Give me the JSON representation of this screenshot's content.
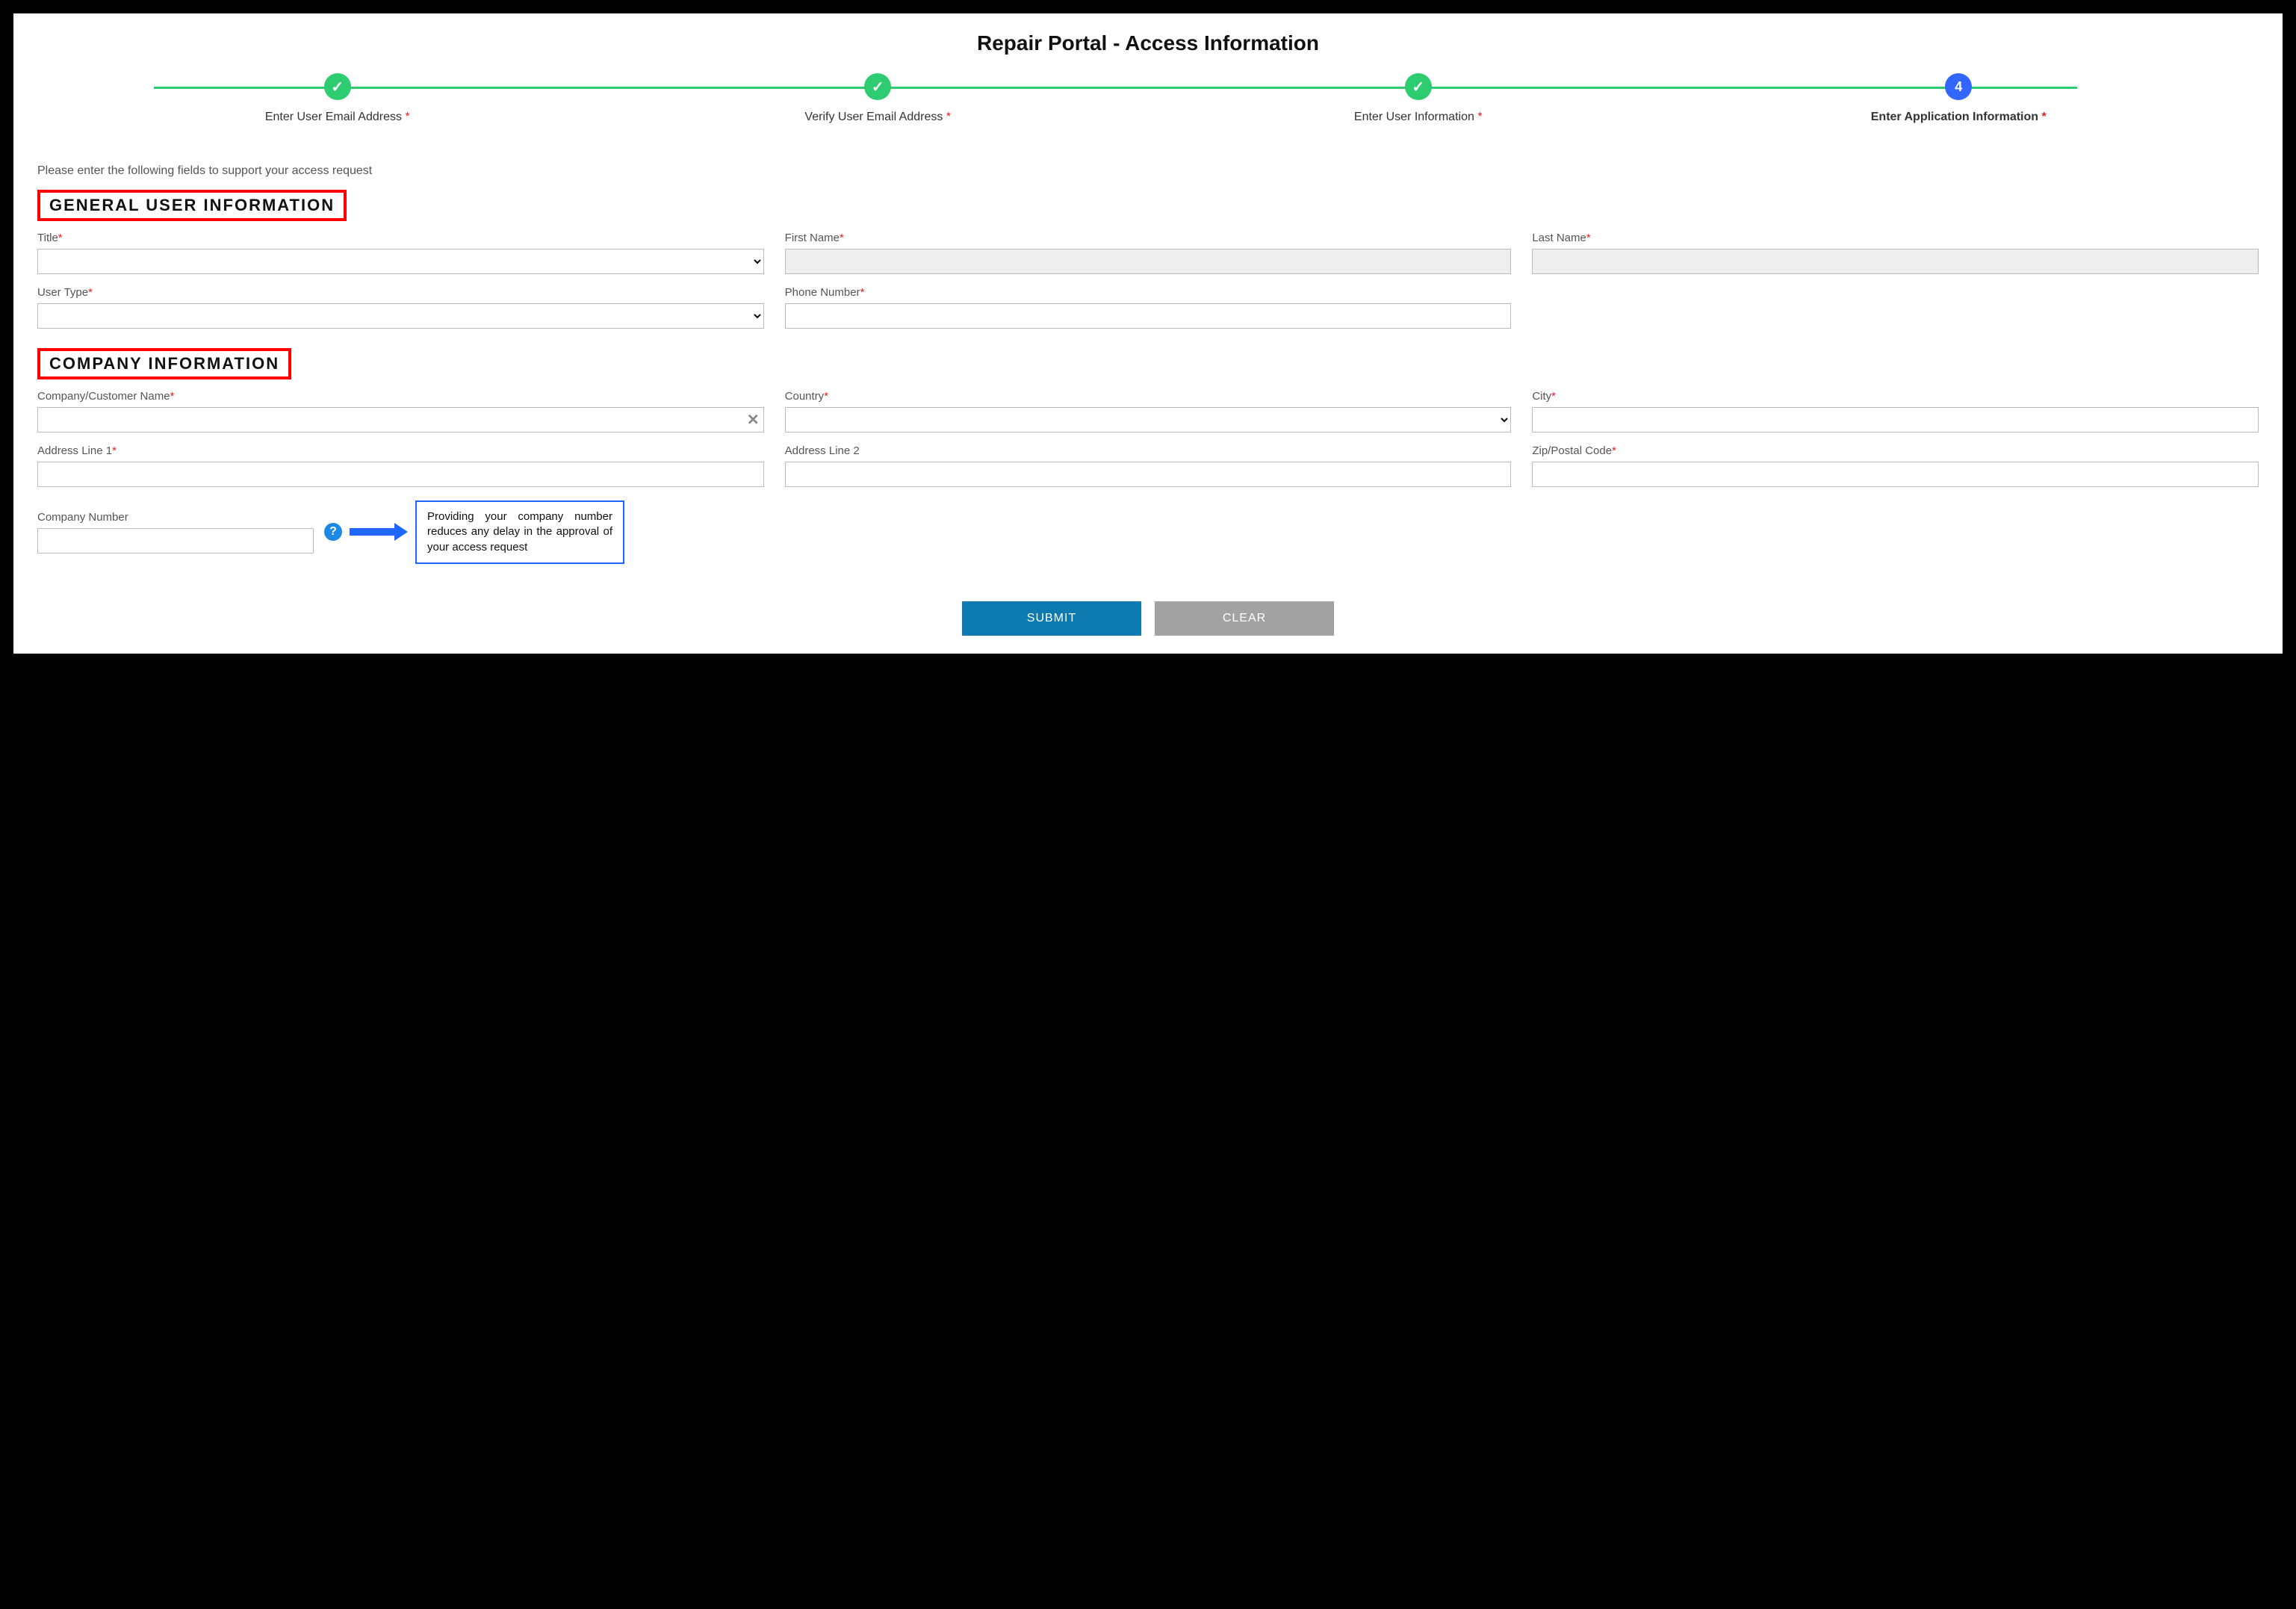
{
  "pageTitle": "Repair Portal - Access Information",
  "stepper": {
    "steps": [
      {
        "label": "Enter User Email Address",
        "status": "done",
        "required": true
      },
      {
        "label": "Verify User Email Address",
        "status": "done",
        "required": true
      },
      {
        "label": "Enter User Information",
        "status": "done",
        "required": true
      },
      {
        "label": "Enter Application Information",
        "status": "current",
        "number": "4",
        "required": true
      }
    ]
  },
  "instruction": "Please enter the following fields to support your access request",
  "sections": {
    "general": {
      "title": "GENERAL USER INFORMATION",
      "fields": {
        "title": {
          "label": "Title",
          "required": true,
          "value": ""
        },
        "firstName": {
          "label": "First Name",
          "required": true,
          "value": ""
        },
        "lastName": {
          "label": "Last Name",
          "required": true,
          "value": ""
        },
        "userType": {
          "label": "User Type",
          "required": true,
          "value": ""
        },
        "phone": {
          "label": "Phone Number",
          "required": true,
          "value": ""
        }
      }
    },
    "company": {
      "title": "COMPANY INFORMATION",
      "fields": {
        "companyName": {
          "label": "Company/Customer Name",
          "required": true,
          "value": ""
        },
        "country": {
          "label": "Country",
          "required": true,
          "value": ""
        },
        "city": {
          "label": "City",
          "required": true,
          "value": ""
        },
        "address1": {
          "label": "Address Line 1",
          "required": true,
          "value": ""
        },
        "address2": {
          "label": "Address Line 2",
          "required": false,
          "value": ""
        },
        "zip": {
          "label": "Zip/Postal Code",
          "required": true,
          "value": ""
        },
        "companyNumber": {
          "label": "Company Number",
          "required": false,
          "value": ""
        }
      }
    }
  },
  "callout": "Providing your company number reduces any delay in the approval of your access request",
  "buttons": {
    "submit": "SUBMIT",
    "clear": "CLEAR"
  }
}
